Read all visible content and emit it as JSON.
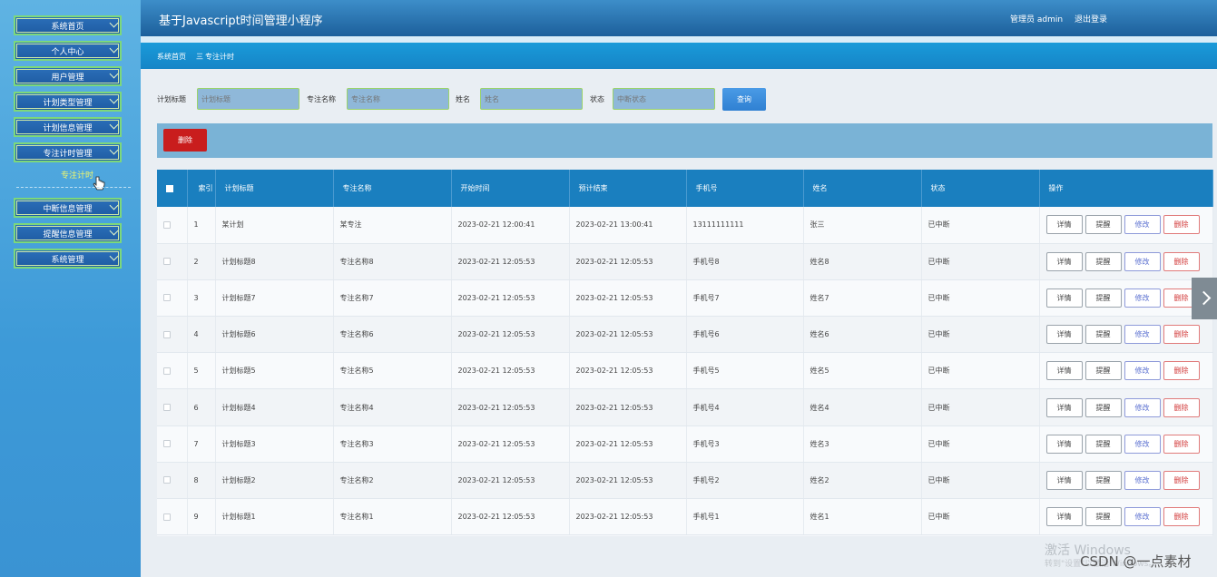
{
  "app": {
    "title": "基于Javascript时间管理小程序",
    "user_label": "管理员 admin",
    "logout_label": "退出登录"
  },
  "sidebar": {
    "items": [
      {
        "label": "系统首页"
      },
      {
        "label": "个人中心"
      },
      {
        "label": "用户管理"
      },
      {
        "label": "计划类型管理"
      },
      {
        "label": "计划信息管理"
      },
      {
        "label": "专注计时管理"
      },
      {
        "label": "中断信息管理"
      },
      {
        "label": "提醒信息管理"
      },
      {
        "label": "系统管理"
      }
    ],
    "active_sub": "专注计时"
  },
  "breadcrumb": {
    "home": "系统首页",
    "separator": "三",
    "current": "专注计时"
  },
  "search": {
    "plan_title_label": "计划标题",
    "plan_title_placeholder": "计划标题",
    "focus_name_label": "专注名称",
    "focus_name_placeholder": "专注名称",
    "name_label": "姓名",
    "name_placeholder": "姓名",
    "status_label": "状态",
    "status_placeholder": "中断状态",
    "query_button": "查询"
  },
  "toolbar": {
    "delete_label": "删除"
  },
  "table": {
    "columns": [
      "",
      "索引",
      "计划标题",
      "专注名称",
      "开始时间",
      "预计结束",
      "手机号",
      "姓名",
      "状态",
      "操作"
    ],
    "actions": {
      "detail": "详情",
      "remind": "提醒",
      "edit": "修改",
      "delete": "删除"
    },
    "rows": [
      {
        "index": "1",
        "plan_title": "某计划",
        "focus_name": "某专注",
        "start": "2023-02-21 12:00:41",
        "end": "2023-02-21 13:00:41",
        "phone": "13111111111",
        "name": "张三",
        "status": "已中断"
      },
      {
        "index": "2",
        "plan_title": "计划标题8",
        "focus_name": "专注名称8",
        "start": "2023-02-21 12:05:53",
        "end": "2023-02-21 12:05:53",
        "phone": "手机号8",
        "name": "姓名8",
        "status": "已中断"
      },
      {
        "index": "3",
        "plan_title": "计划标题7",
        "focus_name": "专注名称7",
        "start": "2023-02-21 12:05:53",
        "end": "2023-02-21 12:05:53",
        "phone": "手机号7",
        "name": "姓名7",
        "status": "已中断"
      },
      {
        "index": "4",
        "plan_title": "计划标题6",
        "focus_name": "专注名称6",
        "start": "2023-02-21 12:05:53",
        "end": "2023-02-21 12:05:53",
        "phone": "手机号6",
        "name": "姓名6",
        "status": "已中断"
      },
      {
        "index": "5",
        "plan_title": "计划标题5",
        "focus_name": "专注名称5",
        "start": "2023-02-21 12:05:53",
        "end": "2023-02-21 12:05:53",
        "phone": "手机号5",
        "name": "姓名5",
        "status": "已中断"
      },
      {
        "index": "6",
        "plan_title": "计划标题4",
        "focus_name": "专注名称4",
        "start": "2023-02-21 12:05:53",
        "end": "2023-02-21 12:05:53",
        "phone": "手机号4",
        "name": "姓名4",
        "status": "已中断"
      },
      {
        "index": "7",
        "plan_title": "计划标题3",
        "focus_name": "专注名称3",
        "start": "2023-02-21 12:05:53",
        "end": "2023-02-21 12:05:53",
        "phone": "手机号3",
        "name": "姓名3",
        "status": "已中断"
      },
      {
        "index": "8",
        "plan_title": "计划标题2",
        "focus_name": "专注名称2",
        "start": "2023-02-21 12:05:53",
        "end": "2023-02-21 12:05:53",
        "phone": "手机号2",
        "name": "姓名2",
        "status": "已中断"
      },
      {
        "index": "9",
        "plan_title": "计划标题1",
        "focus_name": "专注名称1",
        "start": "2023-02-21 12:05:53",
        "end": "2023-02-21 12:05:53",
        "phone": "手机号1",
        "name": "姓名1",
        "status": "已中断"
      }
    ]
  },
  "watermark": {
    "activate": "激活 Windows",
    "activate_sub": "转到\"设置\"以激活 Windows。",
    "csdn": "CSDN @一点素材"
  },
  "colors": {
    "header": "#1c5f9b",
    "breadcrumb": "#1a9ad9",
    "table_header": "#1a7fbf",
    "delete_button": "#c91d1d",
    "query_button": "#2f80d2",
    "active_sub_text": "#f3f86b"
  }
}
